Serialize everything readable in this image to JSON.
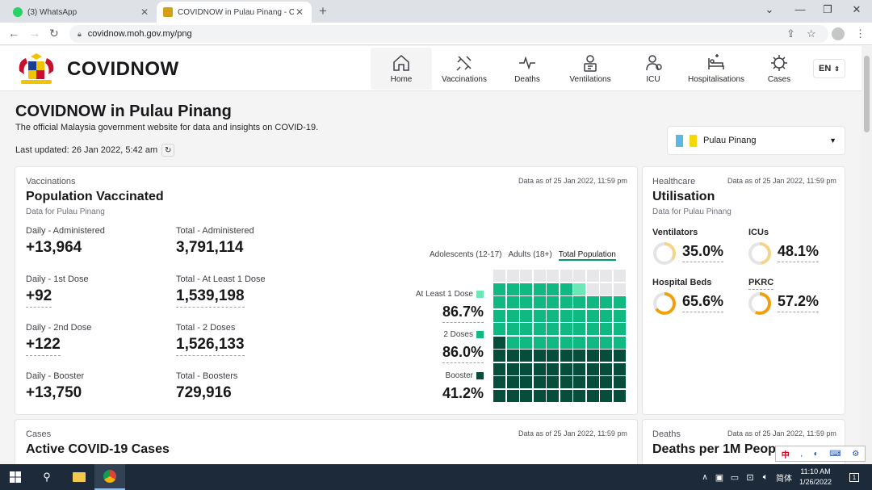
{
  "browser": {
    "tabs": [
      {
        "title": "(3) WhatsApp",
        "favicon": "whatsapp-icon"
      },
      {
        "title": "COVIDNOW in Pulau Pinang - COVIDNOW",
        "favicon": "malaysia-crest-icon"
      }
    ],
    "url": "covidnow.moh.gov.my/png"
  },
  "site": {
    "brand": "COVIDNOW",
    "nav": [
      "Home",
      "Vaccinations",
      "Deaths",
      "Ventilations",
      "ICU",
      "Hospitalisations",
      "Cases"
    ],
    "active_nav": "Home",
    "lang": "EN"
  },
  "page": {
    "title": "COVIDNOW in Pulau Pinang",
    "subtitle": "The official Malaysia government website for data and insights on COVID-19.",
    "last_updated": "Last updated: 26 Jan 2022, 5:42 am",
    "state": "Pulau Pinang"
  },
  "vaccination": {
    "category": "Vaccinations",
    "title": "Population Vaccinated",
    "sub": "Data for Pulau Pinang",
    "as_of": "Data as of 25 Jan 2022, 11:59 pm",
    "stats": [
      {
        "label": "Daily - Administered",
        "value": "+13,964"
      },
      {
        "label": "Total - Administered",
        "value": "3,791,114"
      },
      {
        "label": "Daily - 1st Dose",
        "value": "+92"
      },
      {
        "label": "Total - At Least 1 Dose",
        "value": "1,539,198"
      },
      {
        "label": "Daily - 2nd Dose",
        "value": "+122"
      },
      {
        "label": "Total - 2 Doses",
        "value": "1,526,133"
      },
      {
        "label": "Daily - Booster",
        "value": "+13,750"
      },
      {
        "label": "Total - Boosters",
        "value": "729,916"
      }
    ],
    "tabs": [
      "Adolescents (12-17)",
      "Adults (18+)",
      "Total Population"
    ],
    "active_tab": "Total Population",
    "doses": [
      {
        "label": "At Least 1 Dose",
        "value": "86.7%",
        "pct": 86.7,
        "color": "#6ee7b7"
      },
      {
        "label": "2 Doses",
        "value": "86.0%",
        "pct": 86.0,
        "color": "#10b981"
      },
      {
        "label": "Booster",
        "value": "41.2%",
        "pct": 41.2,
        "color": "#064e3b"
      }
    ]
  },
  "utilisation": {
    "category": "Healthcare",
    "title": "Utilisation",
    "sub": "Data for Pulau Pinang",
    "as_of": "Data as of 25 Jan 2022, 11:59 pm",
    "items": [
      {
        "label": "Ventilators",
        "value": "35.0%",
        "pct": 35.0,
        "color": "#f5d48a"
      },
      {
        "label": "ICUs",
        "value": "48.1%",
        "pct": 48.1,
        "color": "#f5d48a"
      },
      {
        "label": "Hospital Beds",
        "value": "65.6%",
        "pct": 65.6,
        "color": "#f59e0b"
      },
      {
        "label": "PKRC",
        "value": "57.2%",
        "pct": 57.2,
        "color": "#f59e0b"
      }
    ]
  },
  "cases": {
    "category": "Cases",
    "title": "Active COVID-19 Cases",
    "as_of": "Data as of 25 Jan 2022, 11:59 pm"
  },
  "deaths": {
    "category": "Deaths",
    "title": "Deaths per 1M Peop",
    "as_of": "Data as of 25 Jan 2022, 11:59 pm"
  },
  "taskbar": {
    "time": "11:10 AM",
    "date": "1/26/2022",
    "ime": "简体",
    "notifications": "1"
  }
}
